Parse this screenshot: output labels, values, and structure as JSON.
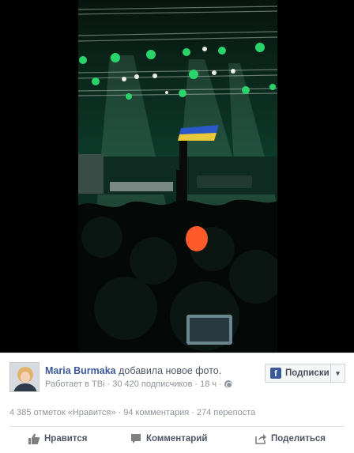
{
  "post": {
    "author": "Maria Burmaka",
    "action": "добавила новое фото.",
    "workplace": "Работает в TBi",
    "subscribers": "30 420 подписчиков",
    "separator": "·",
    "time": "18 ч",
    "privacy_icon": "globe-icon"
  },
  "subscribe": {
    "label": "Подписки",
    "icon": "facebook-icon",
    "logo_letter": "f",
    "caret": "▾"
  },
  "stats": {
    "text": "4 385 отметок «Нравится» · 94 комментария · 274 перепоста"
  },
  "actions": {
    "like": "Нравится",
    "comment": "Комментарий",
    "share": "Поделиться"
  },
  "colors": {
    "link": "#3b5998",
    "muted": "#90949c",
    "stage_green": "#2bd46a"
  }
}
